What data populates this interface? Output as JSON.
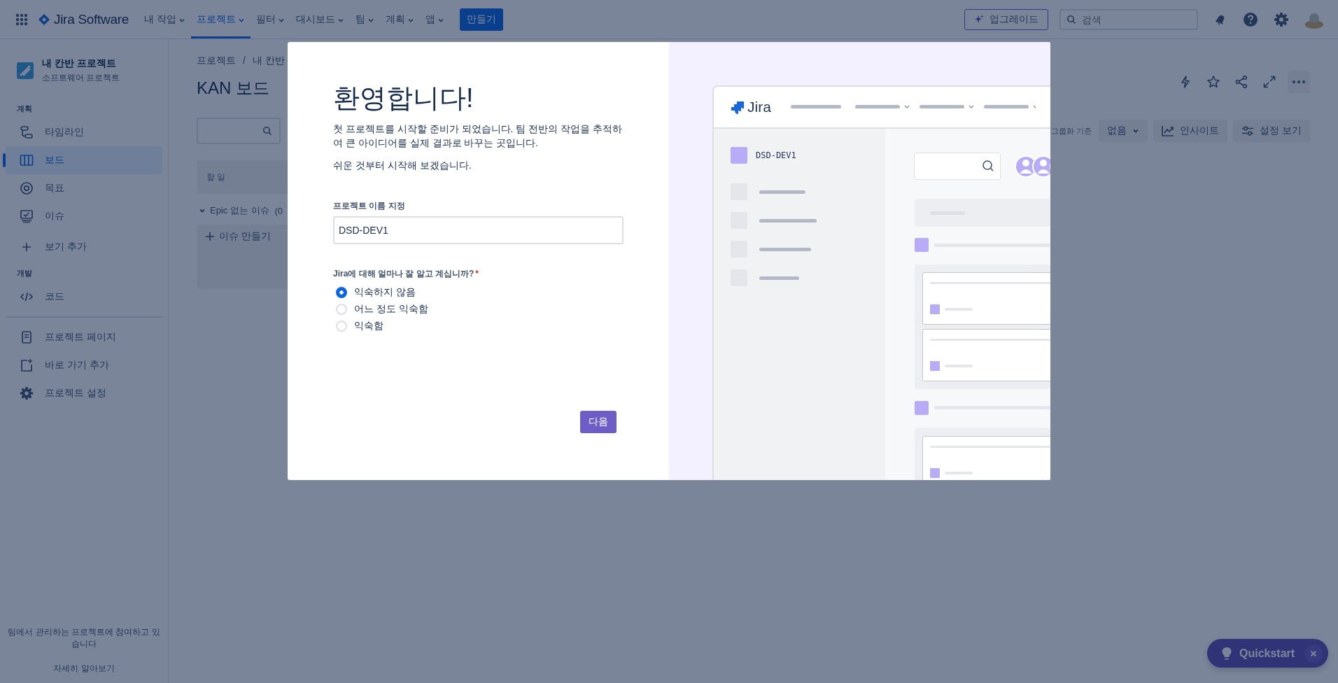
{
  "top_nav": {
    "product": "Jira Software",
    "items": [
      {
        "label": "내 작업",
        "selected": false
      },
      {
        "label": "프로젝트",
        "selected": true
      },
      {
        "label": "필터",
        "selected": false
      },
      {
        "label": "대시보드",
        "selected": false
      },
      {
        "label": "팀",
        "selected": false
      },
      {
        "label": "계획",
        "selected": false
      },
      {
        "label": "앱",
        "selected": false
      }
    ],
    "create_button": "만들기",
    "upgrade_button": "업그레이드",
    "search": {
      "placeholder": "검색"
    }
  },
  "sidebar": {
    "project_name": "내 칸반 프로젝트",
    "project_type": "소프트웨어 프로젝트",
    "planning": {
      "heading": "계획",
      "items": [
        {
          "label": "타임라인",
          "selected": false
        },
        {
          "label": "보드",
          "selected": true
        },
        {
          "label": "목표",
          "selected": false
        },
        {
          "label": "이슈",
          "selected": false
        }
      ]
    },
    "add_view": "보기 추가",
    "development": {
      "heading": "개발",
      "items": [
        {
          "label": "코드",
          "selected": false
        }
      ]
    },
    "links": [
      "프로젝트 페이지",
      "바로 가기 추가",
      "프로젝트 설정"
    ],
    "footer_text": "팀에서 관리하는 프로젝트에 참여하고 있습니다",
    "footer_link": "자세히 알아보기"
  },
  "board": {
    "breadcrumbs": [
      "프로젝트",
      "내 칸반"
    ],
    "breadcrumb_separator": "/",
    "title": "KAN 보드",
    "column": "할 일",
    "group": "Epic 없는 이슈",
    "group_count": "(0",
    "create_issue": "이슈 만들기",
    "group_by_label": "그룹화 기준",
    "group_by_value": "없음",
    "insights_button": "인사이트",
    "view_settings_button": "설정 보기"
  },
  "modal": {
    "title": "환영합니다!",
    "paragraphs": [
      "첫 프로젝트를 시작할 준비가 되었습니다. 팀 전반의 작업을 추적하여 큰 아이디어를 실제 결과로 바꾸는 곳입니다.",
      "쉬운 것부터 시작해 보겠습니다."
    ],
    "name_label": "프로젝트 이름 지정",
    "name_value": "DSD-DEV1",
    "question": "Jira에 대해 얼마나 잘 알고 계십니까?",
    "required_mark": "*",
    "options": [
      {
        "label": "익숙하지 않음",
        "selected": true
      },
      {
        "label": "어느 정도 익숙함",
        "selected": false
      },
      {
        "label": "익숙함",
        "selected": false
      }
    ],
    "next_button": "다음",
    "illustration": {
      "logo_text": "Jira",
      "project": "DSD-DEV1"
    }
  },
  "quickstart": {
    "label": "Quickstart"
  }
}
